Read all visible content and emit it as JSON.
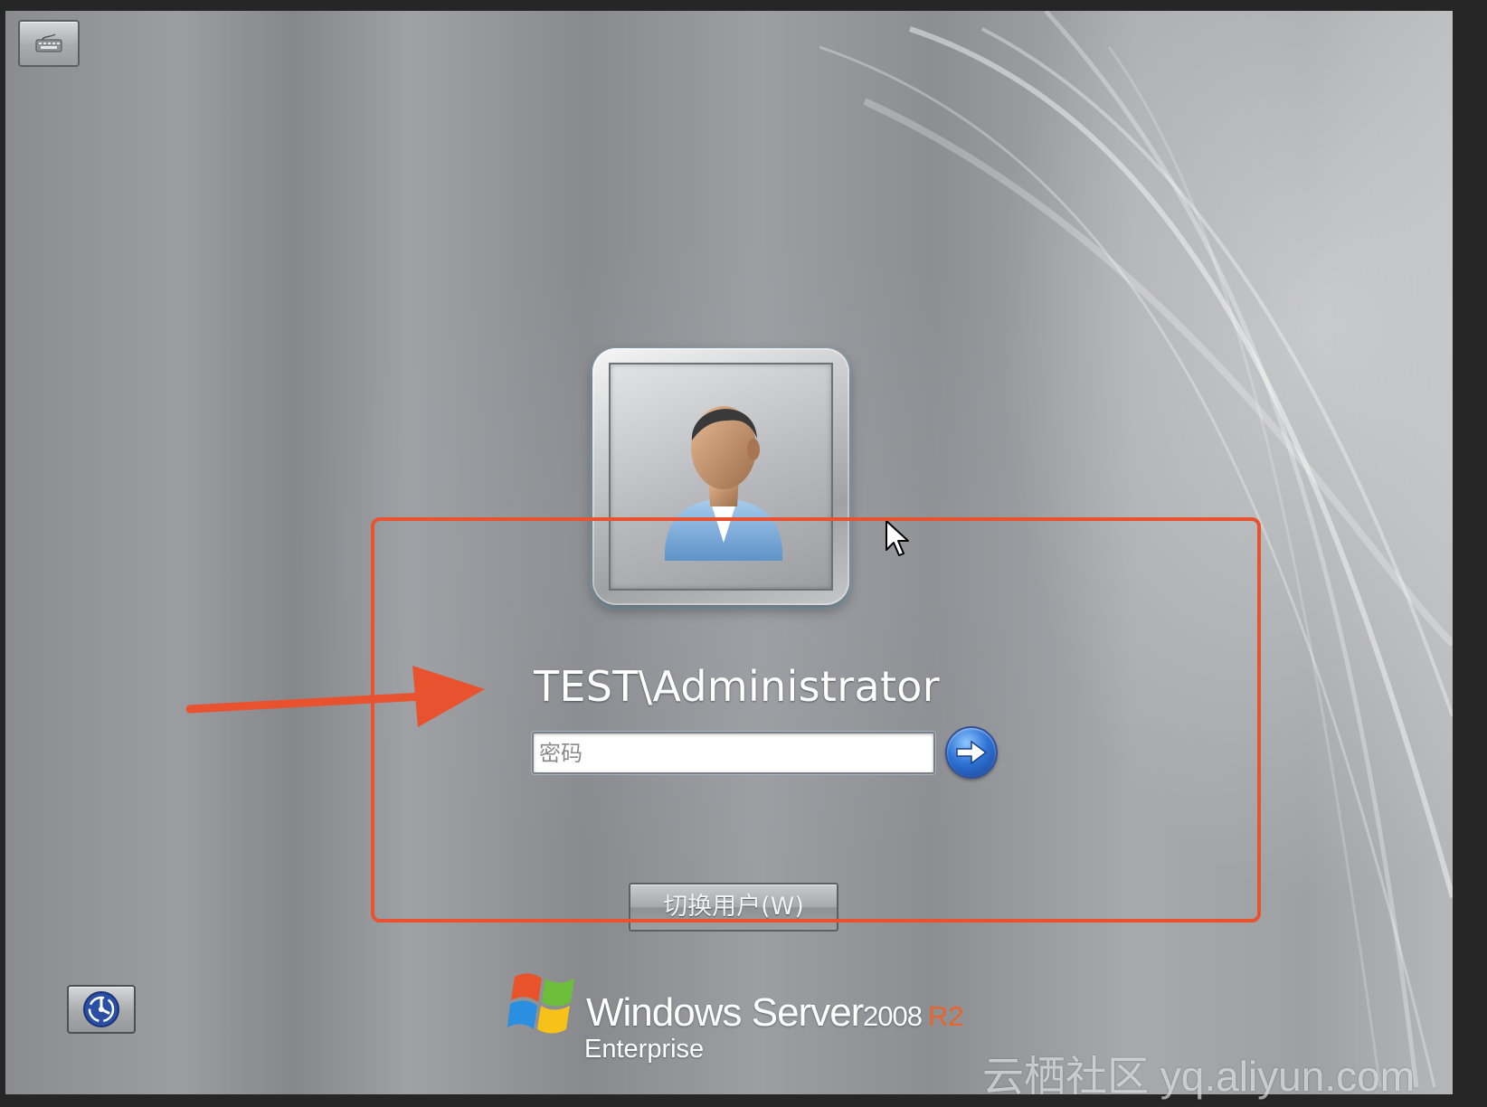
{
  "login": {
    "username": "TEST\\Administrator",
    "password_placeholder": "密码",
    "switch_user_label": "切换用户(W)"
  },
  "branding": {
    "product_name": "Windows Server",
    "version": "2008",
    "release": "R2",
    "edition": "Enterprise"
  },
  "watermark": "云栖社区 yq.aliyun.com",
  "icons": {
    "top_left": "keyboard-icon",
    "submit": "arrow-right-icon",
    "bottom_left": "ease-of-access-icon",
    "avatar": "user-avatar-icon"
  },
  "colors": {
    "annotation": "#e8522f",
    "r2_accent": "#e8642a",
    "submit_blue": "#2f74d6"
  }
}
